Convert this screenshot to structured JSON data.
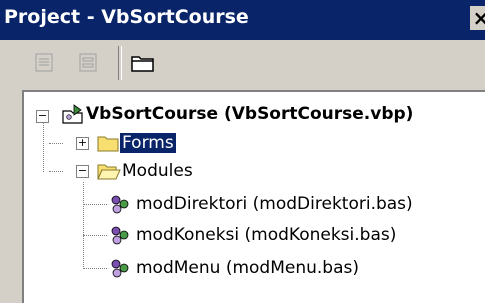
{
  "window": {
    "title": "Project - VbSortCourse",
    "close_label": "×"
  },
  "toolbar": {
    "buttons": [
      {
        "name": "view-code-button",
        "icon": "view-code-icon"
      },
      {
        "name": "view-object-button",
        "icon": "view-object-icon"
      },
      {
        "name": "toggle-folders-button",
        "icon": "folder-icon"
      }
    ]
  },
  "tree": {
    "root": {
      "label": "VbSortCourse (VbSortCourse.vbp)",
      "expanded": true
    },
    "folders": [
      {
        "label": "Forms",
        "expanded": false,
        "selected": true
      },
      {
        "label": "Modules",
        "expanded": true
      }
    ],
    "modules": [
      {
        "label": "modDirektori (modDirektori.bas)"
      },
      {
        "label": "modKoneksi (modKoneksi.bas)"
      },
      {
        "label": "modMenu (modMenu.bas)"
      }
    ],
    "expanders": {
      "collapse": "−",
      "expand": "+"
    }
  }
}
